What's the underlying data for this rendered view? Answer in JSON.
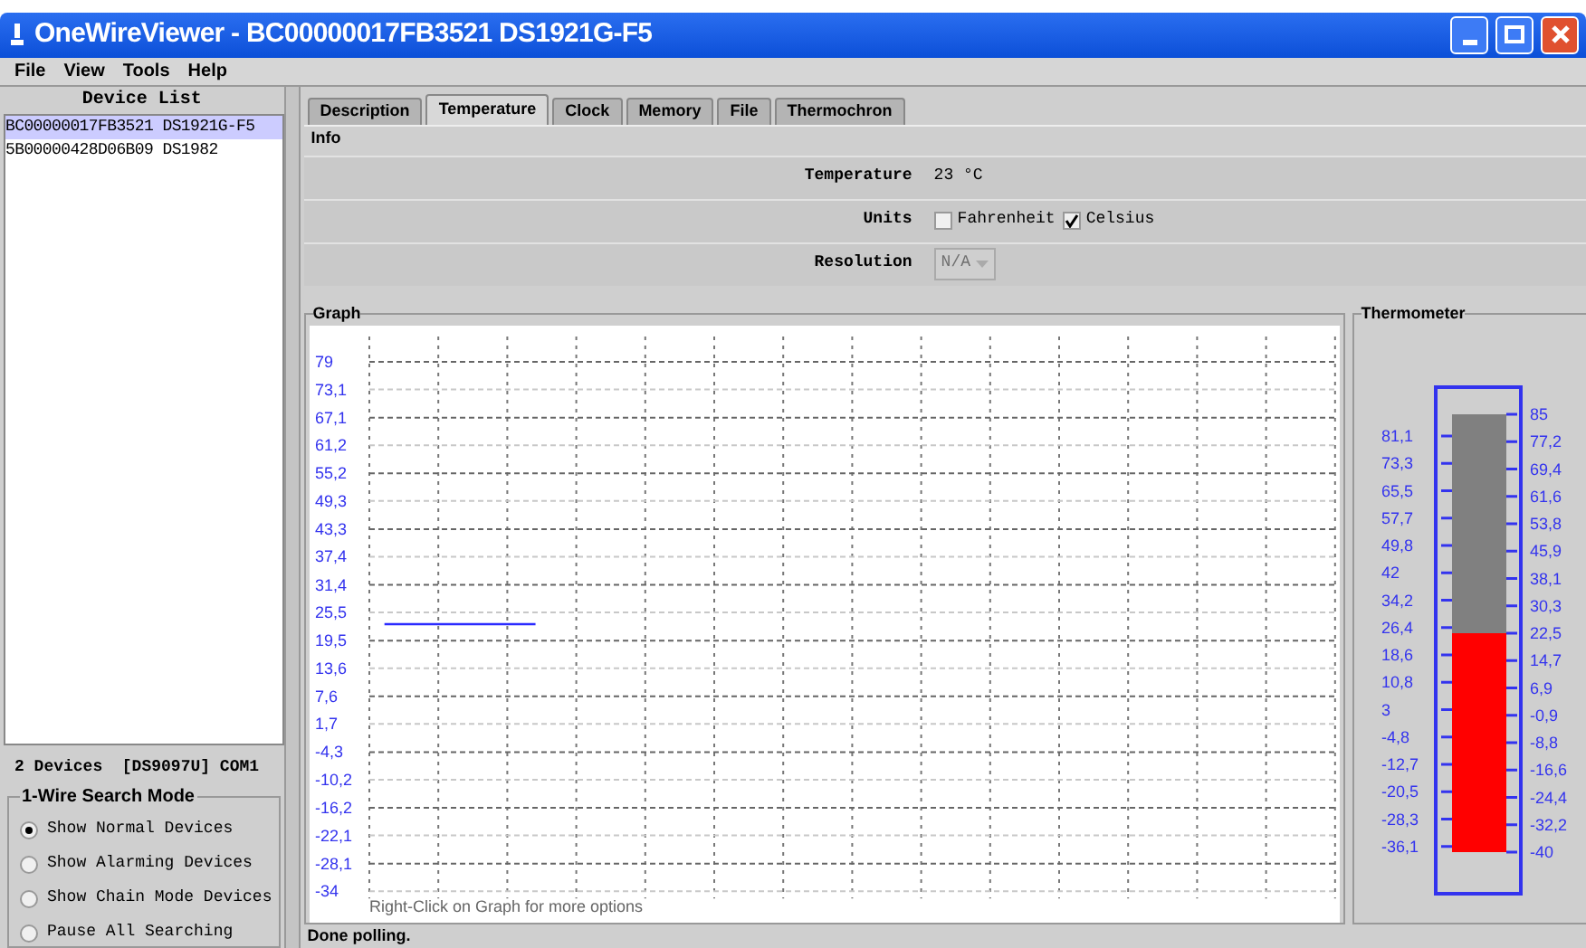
{
  "window": {
    "title": "OneWireViewer - BC00000017FB3521 DS1921G-F5"
  },
  "menu": [
    "File",
    "View",
    "Tools",
    "Help"
  ],
  "device_list": {
    "title": "Device List",
    "items": [
      {
        "label": "BC00000017FB3521 DS1921G-F5",
        "selected": true
      },
      {
        "label": "5B00000428D06B09 DS1982",
        "selected": false
      }
    ]
  },
  "adapter_status": "2 Devices  [DS9097U] COM1",
  "search_mode": {
    "title": "1-Wire Search Mode",
    "options": [
      {
        "label": "Show Normal Devices",
        "selected": true
      },
      {
        "label": "Show Alarming Devices",
        "selected": false
      },
      {
        "label": "Show Chain Mode Devices",
        "selected": false
      },
      {
        "label": "Pause All Searching",
        "selected": false
      }
    ]
  },
  "tabs": [
    {
      "label": "Description",
      "selected": false
    },
    {
      "label": "Temperature",
      "selected": true
    },
    {
      "label": "Clock",
      "selected": false
    },
    {
      "label": "Memory",
      "selected": false
    },
    {
      "label": "File",
      "selected": false
    },
    {
      "label": "Thermochron",
      "selected": false
    }
  ],
  "info": {
    "title": "Info",
    "temperature": {
      "label": "Temperature",
      "value": "23 °C"
    },
    "units": {
      "label": "Units",
      "options": [
        {
          "label": "Fahrenheit",
          "checked": false
        },
        {
          "label": "Celsius",
          "checked": true
        }
      ]
    },
    "resolution": {
      "label": "Resolution",
      "value": "N/A",
      "disabled": true
    }
  },
  "graph": {
    "title": "Graph",
    "hint": "Right-Click on Graph for more options",
    "chart_data": {
      "type": "line",
      "ylim": [
        -34,
        79
      ],
      "yticks": [
        {
          "value": 79,
          "label": "79"
        },
        {
          "value": 73.1,
          "label": "73,1"
        },
        {
          "value": 67.1,
          "label": "67,1"
        },
        {
          "value": 61.2,
          "label": "61,2"
        },
        {
          "value": 55.2,
          "label": "55,2"
        },
        {
          "value": 49.3,
          "label": "49,3"
        },
        {
          "value": 43.3,
          "label": "43,3"
        },
        {
          "value": 37.4,
          "label": "37,4"
        },
        {
          "value": 31.4,
          "label": "31,4"
        },
        {
          "value": 25.5,
          "label": "25,5"
        },
        {
          "value": 19.5,
          "label": "19,5"
        },
        {
          "value": 13.6,
          "label": "13,6"
        },
        {
          "value": 7.6,
          "label": "7,6"
        },
        {
          "value": 1.7,
          "label": "1,7"
        },
        {
          "value": -4.3,
          "label": "-4,3"
        },
        {
          "value": -10.2,
          "label": "-10,2"
        },
        {
          "value": -16.2,
          "label": "-16,2"
        },
        {
          "value": -22.1,
          "label": "-22,1"
        },
        {
          "value": -28.1,
          "label": "-28,1"
        },
        {
          "value": -34,
          "label": "-34"
        }
      ],
      "grid": true,
      "categories": [
        null,
        null,
        null,
        null,
        null,
        null,
        null,
        null,
        null,
        null,
        null,
        null,
        null,
        null,
        null,
        null,
        null,
        null,
        null,
        null,
        null,
        null,
        null,
        null,
        null,
        null,
        null,
        null,
        null,
        null,
        null,
        null
      ],
      "series": [
        {
          "color": "#2b2bff",
          "values": [
            23,
            23,
            23,
            23,
            23,
            23,
            null,
            null,
            null,
            null,
            null,
            null,
            null,
            null,
            null,
            null,
            null,
            null,
            null,
            null,
            null,
            null,
            null,
            null,
            null,
            null,
            null,
            null,
            null,
            null,
            null,
            null
          ]
        }
      ]
    }
  },
  "thermometer": {
    "title": "Thermometer",
    "level": 0.5,
    "left_scale": [
      "81,1",
      "73,3",
      "65,5",
      "57,7",
      "49,8",
      "42",
      "34,2",
      "26,4",
      "18,6",
      "10,8",
      "3",
      "-4,8",
      "-12,7",
      "-20,5",
      "-28,3",
      "-36,1"
    ],
    "right_scale": [
      "85",
      "77,2",
      "69,4",
      "61,6",
      "53,8",
      "45,9",
      "38,1",
      "30,3",
      "22,5",
      "14,7",
      "6,9",
      "-0,9",
      "-8,8",
      "-16,6",
      "-24,4",
      "-32,2",
      "-40"
    ]
  },
  "status_bar": "Done polling."
}
